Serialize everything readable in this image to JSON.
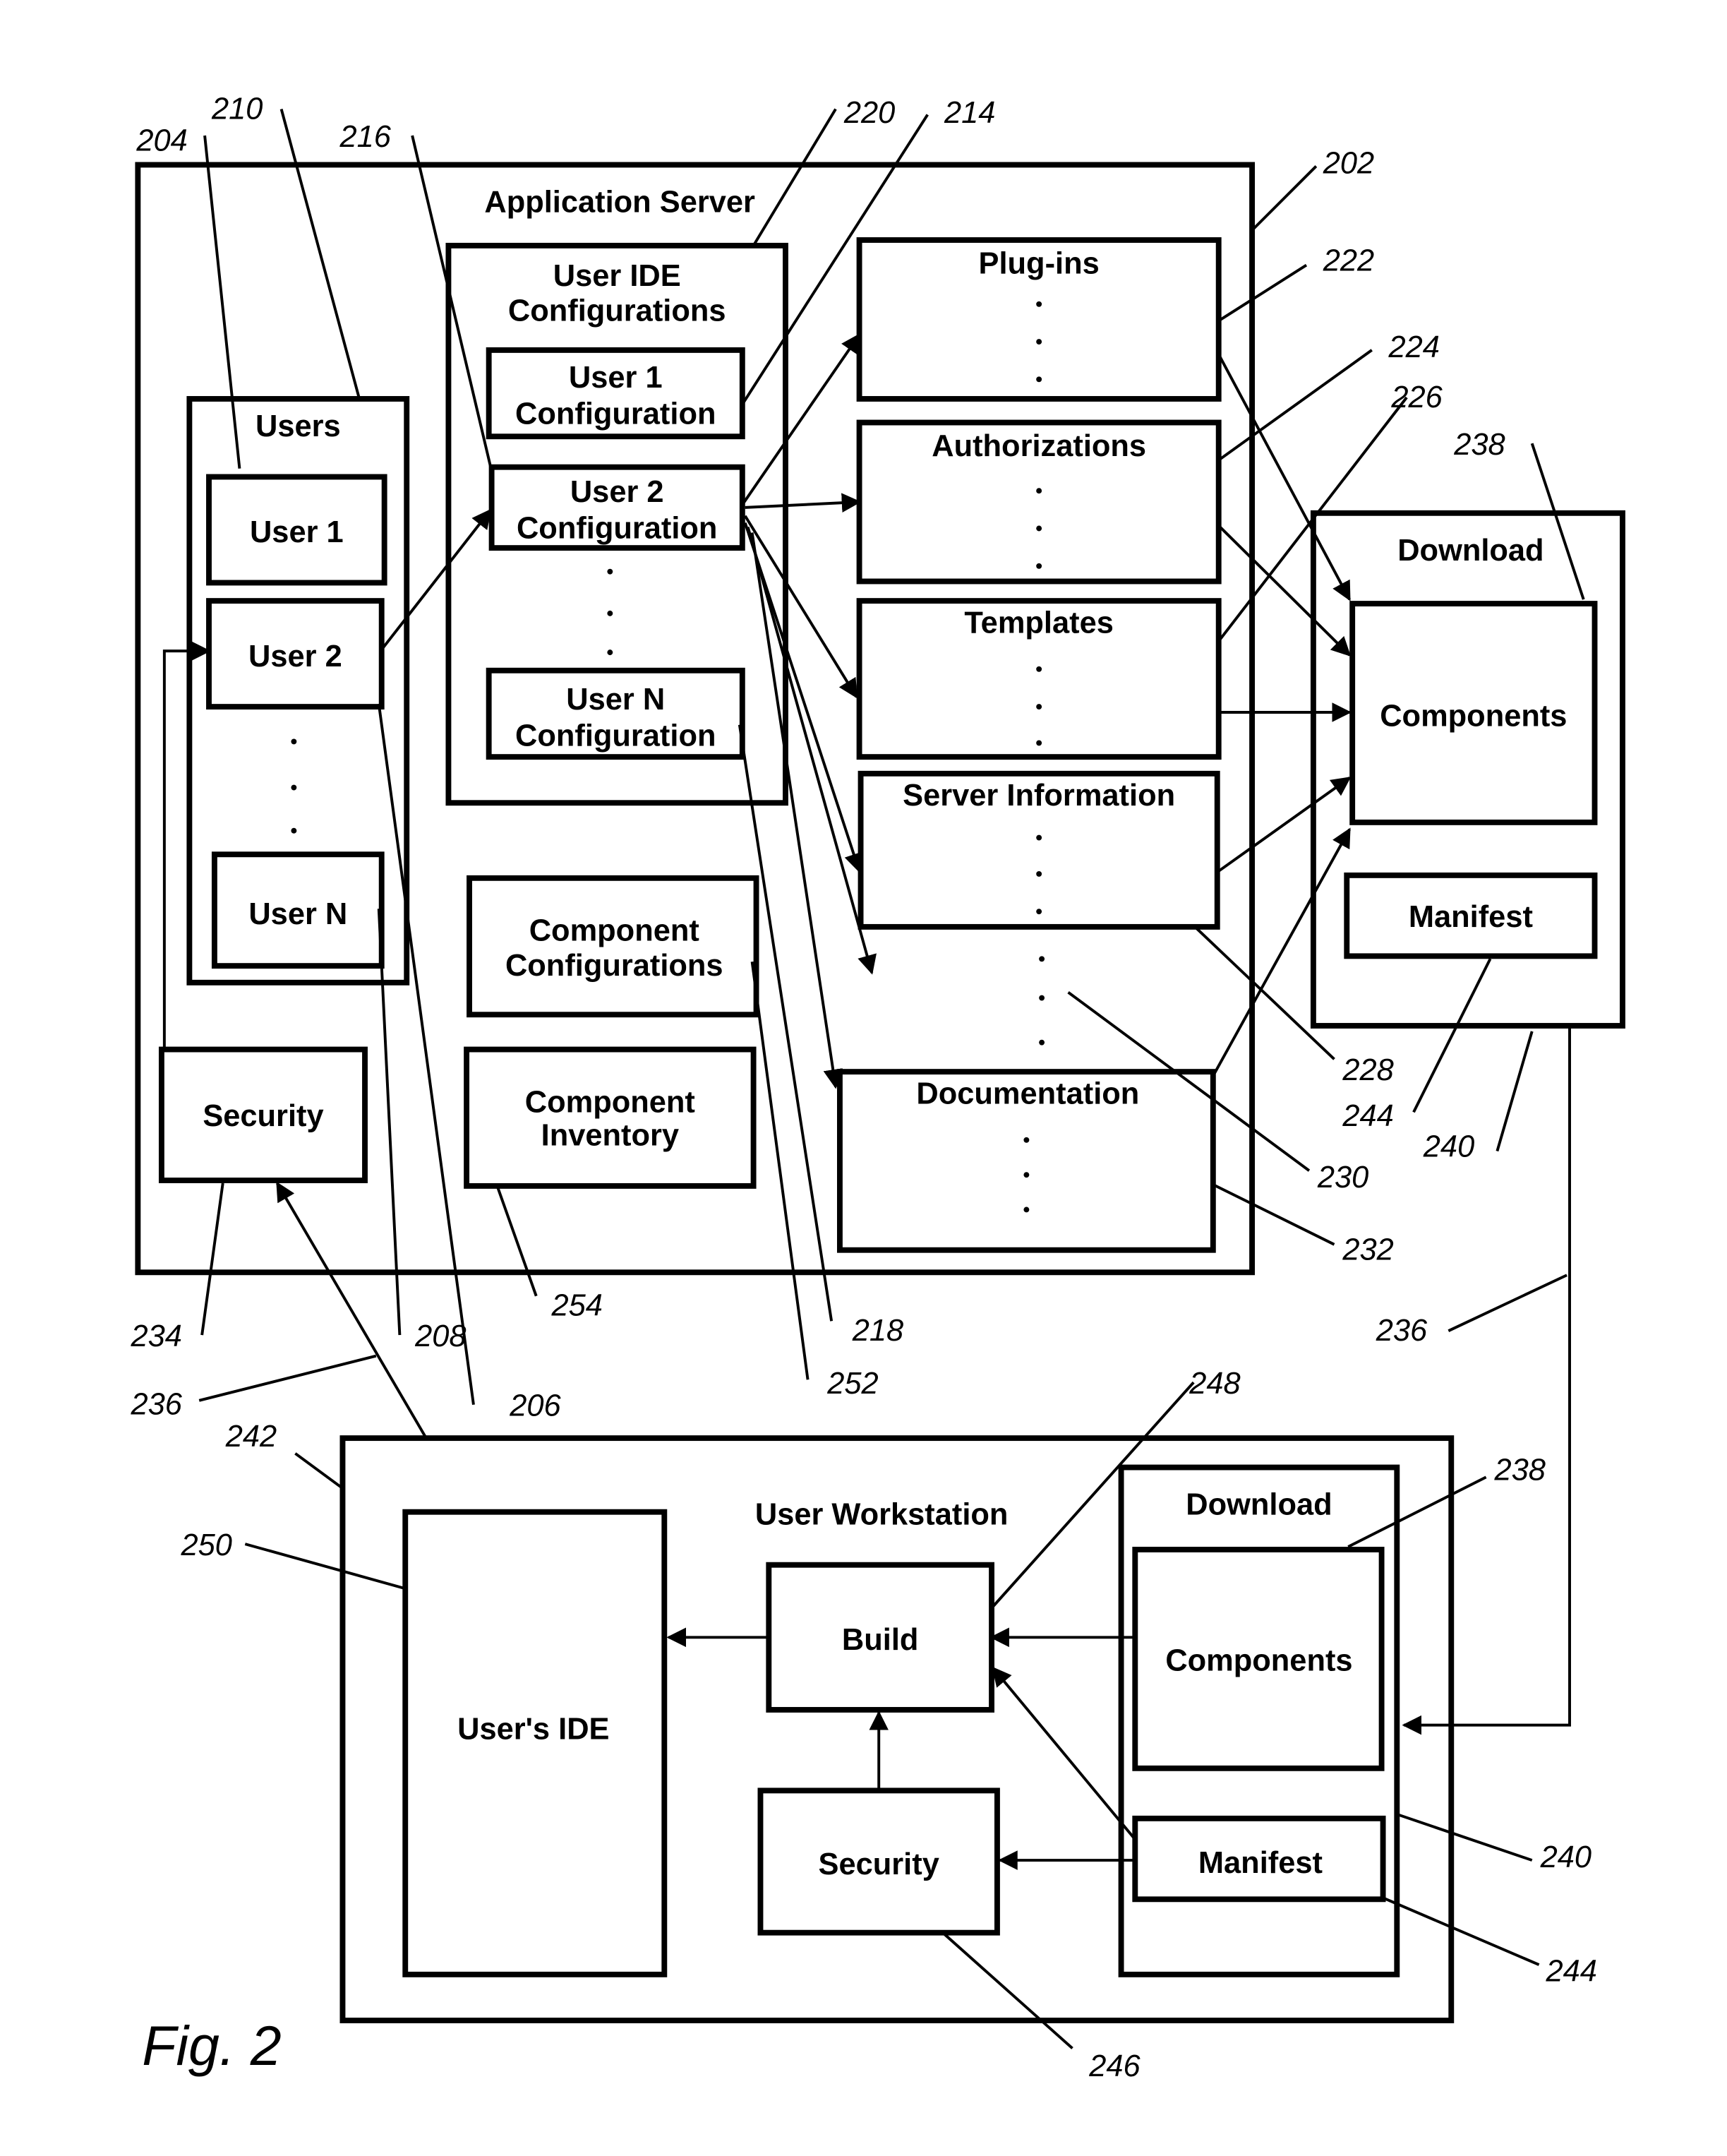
{
  "figure_label": "Fig. 2",
  "application_server": {
    "title": "Application Server",
    "users": {
      "title": "Users",
      "items": [
        "User 1",
        "User 2",
        "User N"
      ]
    },
    "user_ide_configurations": {
      "title_line1": "User IDE",
      "title_line2": "Configurations",
      "items": [
        {
          "line1": "User 1",
          "line2": "Configuration"
        },
        {
          "line1": "User 2",
          "line2": "Configuration"
        },
        {
          "line1": "User N",
          "line2": "Configuration"
        }
      ]
    },
    "security": "Security",
    "component_configurations": {
      "line1": "Component",
      "line2": "Configurations"
    },
    "component_inventory": {
      "line1": "Component",
      "line2": "Inventory"
    },
    "resources": [
      "Plug-ins",
      "Authorizations",
      "Templates",
      "Server Information",
      "Documentation"
    ]
  },
  "server_download": {
    "title": "Download",
    "components": "Components",
    "manifest": "Manifest"
  },
  "user_workstation": {
    "title": "User Workstation",
    "users_ide": "User's IDE",
    "build": "Build",
    "security": "Security",
    "download": {
      "title": "Download",
      "components": "Components",
      "manifest": "Manifest"
    }
  },
  "reference_numerals": {
    "r202": "202",
    "r204": "204",
    "r206": "206",
    "r208": "208",
    "r210": "210",
    "r214": "214",
    "r216": "216",
    "r218": "218",
    "r220": "220",
    "r222": "222",
    "r224": "224",
    "r226": "226",
    "r228": "228",
    "r230": "230",
    "r232": "232",
    "r234": "234",
    "r236a": "236",
    "r236b": "236",
    "r238a": "238",
    "r238b": "238",
    "r240a": "240",
    "r240b": "240",
    "r242": "242",
    "r244a": "244",
    "r244b": "244",
    "r246": "246",
    "r248": "248",
    "r250": "250",
    "r252": "252",
    "r254": "254"
  }
}
